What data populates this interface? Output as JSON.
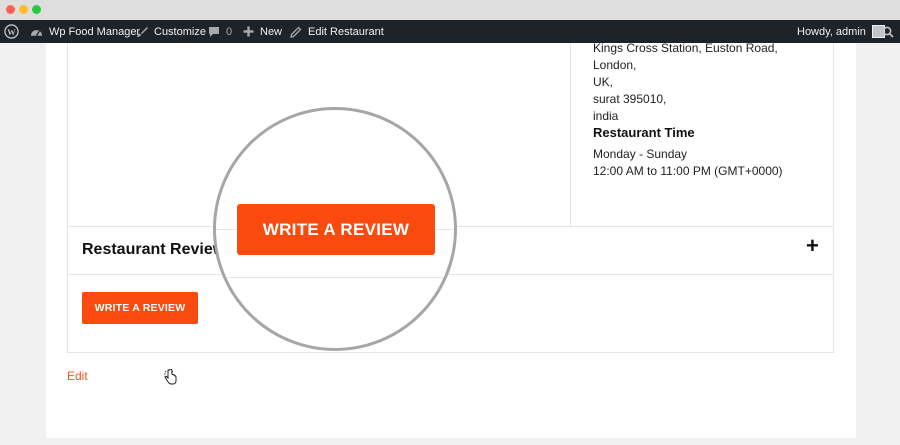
{
  "adminbar": {
    "site_name": "Wp Food Manager",
    "customize": "Customize",
    "comments_count": "0",
    "new_label": "New",
    "edit_label": "Edit Restaurant",
    "howdy": "Howdy, admin"
  },
  "restaurant": {
    "address_lines": [
      "Kings Cross Station, Euston Road, London,",
      "UK,",
      "surat 395010,",
      "india"
    ],
    "time_title": "Restaurant Time",
    "time_days": "Monday - Sunday",
    "time_hours": "12:00 AM to 11:00 PM (GMT+0000)"
  },
  "reviews": {
    "title": "Restaurant Reviews",
    "toggle": "+",
    "button_label": "WRITE A REVIEW",
    "magnified_button_label": "WRITE A REVIEW"
  },
  "footer": {
    "edit_link": "Edit"
  },
  "colors": {
    "accent": "#fb4a0e",
    "adminbar_bg": "#1d2327"
  }
}
